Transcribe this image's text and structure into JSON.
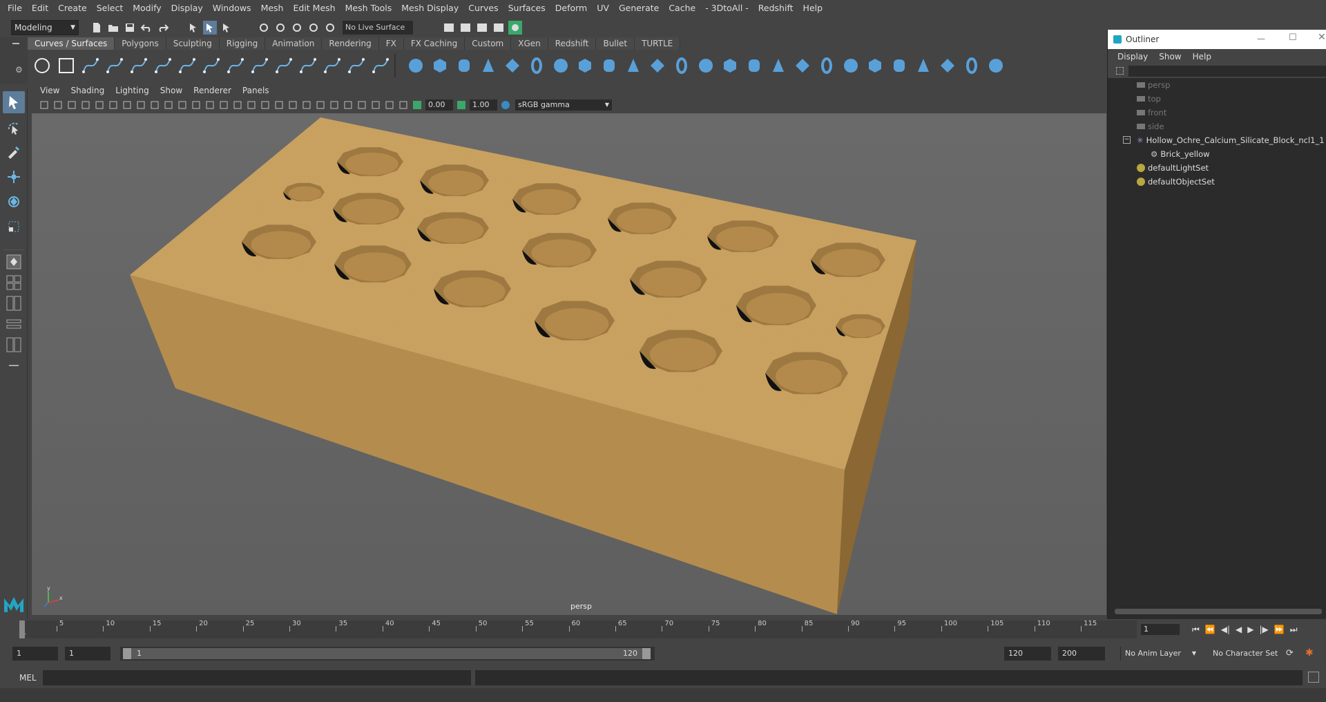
{
  "menubar": {
    "items": [
      "File",
      "Edit",
      "Create",
      "Select",
      "Modify",
      "Display",
      "Windows",
      "Mesh",
      "Edit Mesh",
      "Mesh Tools",
      "Mesh Display",
      "Curves",
      "Surfaces",
      "Deform",
      "UV",
      "Generate",
      "Cache",
      "- 3DtoAll -",
      "Redshift",
      "Help"
    ]
  },
  "status": {
    "mode": "Modeling",
    "live_surface": "No Live Surface"
  },
  "shelf": {
    "tabs": [
      "Curves / Surfaces",
      "Polygons",
      "Sculpting",
      "Rigging",
      "Animation",
      "Rendering",
      "FX",
      "FX Caching",
      "Custom",
      "XGen",
      "Redshift",
      "Bullet",
      "TURTLE"
    ],
    "active_tab": "Curves / Surfaces"
  },
  "panel": {
    "menus": [
      "View",
      "Shading",
      "Lighting",
      "Show",
      "Renderer",
      "Panels"
    ],
    "exposure": "0.00",
    "gamma_value": "1.00",
    "color_space": "sRGB gamma",
    "camera_label": "persp"
  },
  "outliner": {
    "title": "Outliner",
    "menus": [
      "Display",
      "Show",
      "Help"
    ],
    "items": [
      {
        "label": "persp",
        "kind": "camera",
        "dim": true
      },
      {
        "label": "top",
        "kind": "camera",
        "dim": true
      },
      {
        "label": "front",
        "kind": "camera",
        "dim": true
      },
      {
        "label": "side",
        "kind": "camera",
        "dim": true
      },
      {
        "label": "Hollow_Ochre_Calcium_Silicate_Block_ncl1_1",
        "kind": "group",
        "dim": false
      },
      {
        "label": "Brick_yellow",
        "kind": "mesh",
        "dim": false
      },
      {
        "label": "defaultLightSet",
        "kind": "set",
        "dim": false
      },
      {
        "label": "defaultObjectSet",
        "kind": "set",
        "dim": false
      }
    ]
  },
  "timeline": {
    "ticks": [
      "1",
      "5",
      "10",
      "15",
      "20",
      "25",
      "30",
      "35",
      "40",
      "45",
      "50",
      "55",
      "60",
      "65",
      "70",
      "75",
      "80",
      "85",
      "90",
      "95",
      "100",
      "105",
      "110",
      "115"
    ],
    "current_frame": "1"
  },
  "range": {
    "start": "1",
    "start_inner": "1",
    "slider_start": "1",
    "slider_end": "120",
    "end_inner": "120",
    "end": "200",
    "anim_layer": "No Anim Layer",
    "char_set": "No Character Set"
  },
  "cmdline": {
    "label": "MEL"
  },
  "colors": {
    "brick_top": "#c49a56",
    "brick_front": "#b28949",
    "brick_side": "#8f6c38",
    "accent": "#5d7d9a"
  }
}
